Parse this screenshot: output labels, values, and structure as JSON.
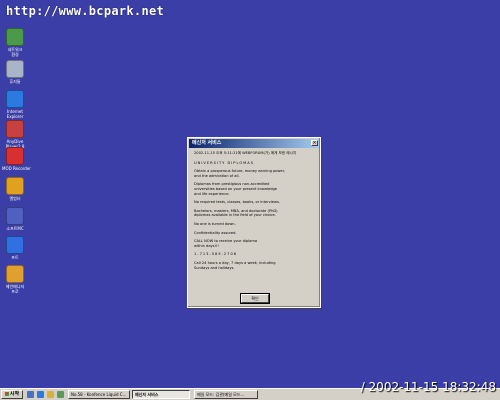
{
  "url_overlay": "http://www.bcpark.net",
  "desktop_icons": [
    {
      "label": "네트워크\n환경",
      "icon": "network-icon",
      "color": "#4a9a4a"
    },
    {
      "label": "휴지통",
      "icon": "recycle-bin-icon",
      "color": "#aab4c8"
    },
    {
      "label": "Internet\nExplorer",
      "icon": "internet-explorer-icon",
      "color": "#2a7ae0"
    },
    {
      "label": "AnyDive\nPlayer2.8",
      "icon": "player-icon",
      "color": "#c84040"
    },
    {
      "label": "MOD Recorder",
      "icon": "recorder-icon",
      "color": "#d83030"
    },
    {
      "label": "앨범터",
      "icon": "album-icon",
      "color": "#e0a020"
    },
    {
      "label": "소프트MC",
      "icon": "software-icon",
      "color": "#5060c0"
    },
    {
      "label": "프트",
      "icon": "app-icon",
      "color": "#3070e0"
    },
    {
      "label": "메인메니저\n프로",
      "icon": "manager-icon",
      "color": "#e0a030"
    }
  ],
  "dialog": {
    "title": "메신저 서비스",
    "header": "2002-11-15 오후 5:11:21에 WEBFORUM(가) 에게 보낸 메시지",
    "paragraphs": [
      "UNIVERSITY DIPLOMAS",
      "Obtain a prosperous future, money earning power,\nand the admiration of all.",
      "Diplomas from prestigious non-accredited\nuniversities based on your present knowledge\nand life experience.",
      "No required tests, classes, books, or interviews.",
      "Bachelors, masters, MBA, and doctorate (PhD)\ndiplomas available in the field of your choice.",
      "No one is turned down.",
      "Confidentiality assured.",
      "CALL NOW to receive your diploma\nwithin days!!!",
      "1-713-589-2706",
      "Call 24 hours a day, 7 days a week, including\nSundays and holidays."
    ],
    "ok_label": "확인"
  },
  "taskbar": {
    "start_label": "시작",
    "quick_launch": [
      "desktop-icon",
      "ie-icon",
      "outlook-icon",
      "media-icon"
    ],
    "tasks": [
      {
        "label": "No.58 - Konfence Liquid C...",
        "active": false
      },
      {
        "label": "메신저 서비스",
        "active": true
      },
      {
        "label": "",
        "active": false
      },
      {
        "label": "메일 모드: 김관(메일 모드...",
        "active": false
      }
    ]
  },
  "clock_overlay": "2002-11-15 18:32:48",
  "colors": {
    "desktop": "#3a3ea6",
    "titlebar": "#0a246a",
    "face": "#d4d0c8"
  }
}
